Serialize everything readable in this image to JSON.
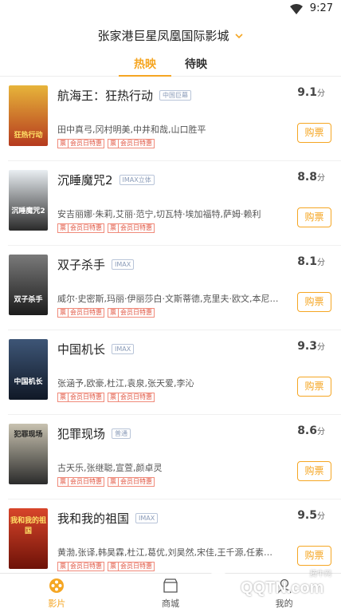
{
  "status": {
    "time": "9:27"
  },
  "header": {
    "cinema_name": "张家港巨星凤凰国际影城"
  },
  "tabs": [
    {
      "label": "热映",
      "active": true
    },
    {
      "label": "待映",
      "active": false
    }
  ],
  "movies": [
    {
      "title": "航海王：狂热行动",
      "badge": "中国巨幕",
      "score": "9.1",
      "unit": "分",
      "cast": "田中真弓,冈村明美,中井和哉,山口胜平",
      "tag1": "票",
      "tag2": "会员日特惠",
      "buy": "购票",
      "poster_caption": "狂热行动",
      "poster_colors": [
        "#e7b43a",
        "#b53a1e"
      ]
    },
    {
      "title": "沉睡魔咒2",
      "badge": "IMAX立体",
      "score": "8.8",
      "unit": "分",
      "cast": "安吉丽娜·朱莉,艾丽·范宁,切瓦特·埃加福特,萨姆·赖利",
      "tag1": "票",
      "tag2": "会员日特惠",
      "buy": "购票",
      "poster_caption": "沉睡魔咒2",
      "poster_colors": [
        "#e9eef2",
        "#2a2a2a"
      ]
    },
    {
      "title": "双子杀手",
      "badge": "IMAX",
      "score": "8.1",
      "unit": "分",
      "cast": "威尔·史密斯,玛丽·伊丽莎白·文斯蒂德,克里夫·欧文,本尼迪克特·王",
      "tag1": "票",
      "tag2": "会员日特惠",
      "buy": "购票",
      "poster_caption": "双子杀手",
      "poster_colors": [
        "#7a7a7a",
        "#1c1c1c"
      ]
    },
    {
      "title": "中国机长",
      "badge": "IMAX",
      "score": "9.3",
      "unit": "分",
      "cast": "张涵予,欧豪,杜江,袁泉,张天爱,李沁",
      "tag1": "票",
      "tag2": "会员日特惠",
      "buy": "购票",
      "poster_caption": "中国机长",
      "poster_colors": [
        "#3e5677",
        "#101826"
      ]
    },
    {
      "title": "犯罪现场",
      "badge": "普通",
      "score": "8.6",
      "unit": "分",
      "cast": "古天乐,张继聪,宣萱,颜卓灵",
      "tag1": "票",
      "tag2": "会员日特惠",
      "buy": "购票",
      "poster_caption": "犯罪现场",
      "poster_colors": [
        "#c8c2b0",
        "#2b2b2b"
      ]
    },
    {
      "title": "我和我的祖国",
      "badge": "IMAX",
      "score": "9.5",
      "unit": "分",
      "cast": "黄渤,张译,韩昊霖,杜江,葛优,刘昊然,宋佳,王千源,任素汐,吴京,朱一龙",
      "tag1": "票",
      "tag2": "会员日特惠",
      "buy": "购票",
      "poster_caption": "我和我的祖国",
      "poster_colors": [
        "#d8452a",
        "#6e1208"
      ]
    }
  ],
  "tabbar": [
    {
      "label": "影片",
      "icon": "film-reel-icon",
      "active": true
    },
    {
      "label": "商城",
      "icon": "shop-icon",
      "active": false
    },
    {
      "label": "我的",
      "icon": "user-icon",
      "active": false
    }
  ],
  "watermark": {
    "text": "QQTN.com",
    "sub": "腾牛网"
  },
  "colors": {
    "accent": "#f5a623",
    "tag": "#e0533f"
  }
}
